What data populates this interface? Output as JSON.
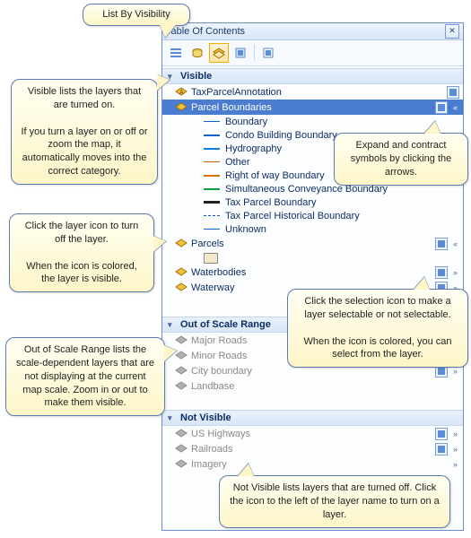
{
  "panel": {
    "title": "Table Of Contents"
  },
  "sections": {
    "visible": "Visible",
    "outOfScale": "Out of Scale Range",
    "notVisible": "Not Visible"
  },
  "layers": {
    "taxParcelAnnotation": "TaxParcelAnnotation",
    "parcelBoundaries": "Parcel Boundaries",
    "parcels": "Parcels",
    "waterbodies": "Waterbodies",
    "waterway": "Waterway",
    "majorRoads": "Major Roads",
    "minorRoads": "Minor Roads",
    "cityBoundary": "City boundary",
    "landbase": "Landbase",
    "usHighways": "US Highways",
    "railroads": "Railroads",
    "imagery": "Imagery"
  },
  "symbols": [
    {
      "label": "Boundary",
      "color": "#1060d0",
      "style": "solid",
      "w": 1
    },
    {
      "label": "Condo Building Boundary",
      "color": "#1060d0",
      "style": "solid",
      "w": 2
    },
    {
      "label": "Hydrography",
      "color": "#0a7fe0",
      "style": "solid",
      "w": 2
    },
    {
      "label": "Other",
      "color": "#d06000",
      "style": "solid",
      "w": 1
    },
    {
      "label": "Right of way Boundary",
      "color": "#e07000",
      "style": "solid",
      "w": 2
    },
    {
      "label": "Simultaneous Conveyance Boundary",
      "color": "#10a040",
      "style": "solid",
      "w": 2
    },
    {
      "label": "Tax Parcel Boundary",
      "color": "#202020",
      "style": "solid",
      "w": 3
    },
    {
      "label": "Tax Parcel Historical Boundary",
      "color": "#1050c0",
      "style": "dash",
      "w": 1
    },
    {
      "label": "Unknown",
      "color": "#1060d0",
      "style": "solid",
      "w": 1
    }
  ],
  "callouts": {
    "listBy": "List By Visibility",
    "visible": "Visible lists the layers that are turned on.\n\nIf you turn a layer on or off or zoom the map, it automatically moves into the correct category.",
    "expand": "Expand and contract symbols by clicking the arrows.",
    "layerIcon": "Click the layer icon to turn off the layer.\n\nWhen the icon is colored, the layer is visible.",
    "selection": "Click the selection icon to make a layer selectable or not selectable.\n\nWhen the icon is colored, you can select from the layer.",
    "outOfScale": "Out of Scale Range lists the scale-dependent layers that are not displaying at the current map scale. Zoom in or out to make them visible.",
    "notVisible": "Not Visible lists layers that are turned off. Click the icon to the left of the layer name to turn on a layer."
  }
}
